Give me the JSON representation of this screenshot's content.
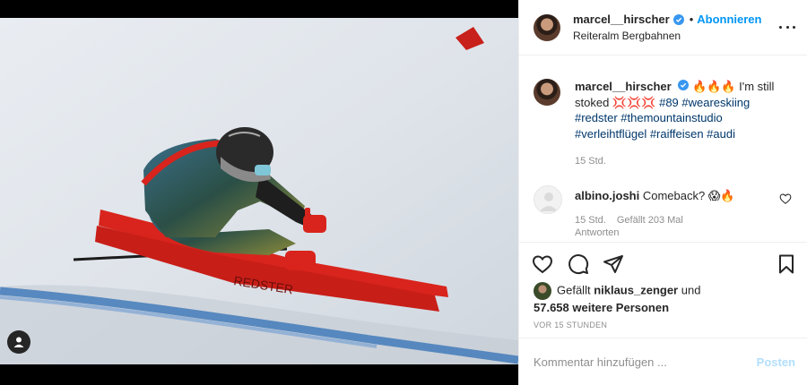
{
  "post": {
    "author": "marcel__hirscher",
    "location": "Reiteralm Bergbahnen",
    "follow_label": "Abonnieren",
    "dot": "•",
    "more_icon": "more-dots-icon",
    "caption": {
      "fire_emojis": "🔥🔥🔥",
      "text_1": " I'm still stoked ",
      "boom_emojis": "💢💢💢",
      "hashtags_1": " #89 #weareskiing",
      "hashtags_2": "#redster #themountainstudio",
      "hashtags_3": "#verleihtflügel #raiffeisen #audi",
      "time": "15 Std."
    },
    "comments": [
      {
        "user": "albino.joshi",
        "text": "Comeback? 😱🔥",
        "time": "15 Std.",
        "likes": "Gefällt 203 Mal",
        "reply": "Antworten"
      }
    ],
    "likes": {
      "prefix": "Gefällt ",
      "user": "niklaus_zenger",
      "mid": " und",
      "count": "57.658 weitere Personen"
    },
    "ago": "VOR 15 STUNDEN",
    "composer": {
      "placeholder": "Kommentar hinzufügen ...",
      "post_label": "Posten"
    }
  },
  "colors": {
    "accent": "#0095f6",
    "ski_red": "#d8241c",
    "hashtag": "#00376b",
    "muted": "#8e8e8e"
  }
}
